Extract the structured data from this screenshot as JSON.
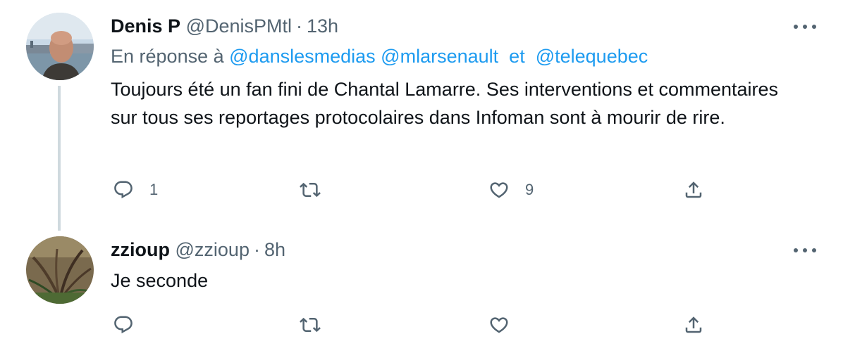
{
  "tweets": [
    {
      "author_name": "Denis P",
      "handle": "@DenisPMtl",
      "separator": "·",
      "time": "13h",
      "reply_prefix": "En réponse à",
      "mentions": [
        "@danslesmedias",
        "@mlarsenault",
        "@telequebec"
      ],
      "mention_joiner": "et",
      "text": "Toujours été un fan fini de Chantal Lamarre. Ses interventions et commentaires sur tous ses reportages protocolaires dans Infoman sont à mourir de rire.",
      "reply_count": "1",
      "retweet_count": "",
      "like_count": "9",
      "icons": [
        "more-icon",
        "reply-icon",
        "retweet-icon",
        "like-icon",
        "share-icon"
      ]
    },
    {
      "author_name": "zzioup",
      "handle": "@zzioup",
      "separator": "·",
      "time": "8h",
      "text": "Je seconde",
      "reply_count": "",
      "retweet_count": "",
      "like_count": "",
      "icons": [
        "more-icon",
        "reply-icon",
        "retweet-icon",
        "like-icon",
        "share-icon"
      ]
    }
  ],
  "colors": {
    "text_primary": "#0f1419",
    "text_secondary": "#536471",
    "link": "#1d9bf0",
    "thread_line": "#cfd9de"
  }
}
